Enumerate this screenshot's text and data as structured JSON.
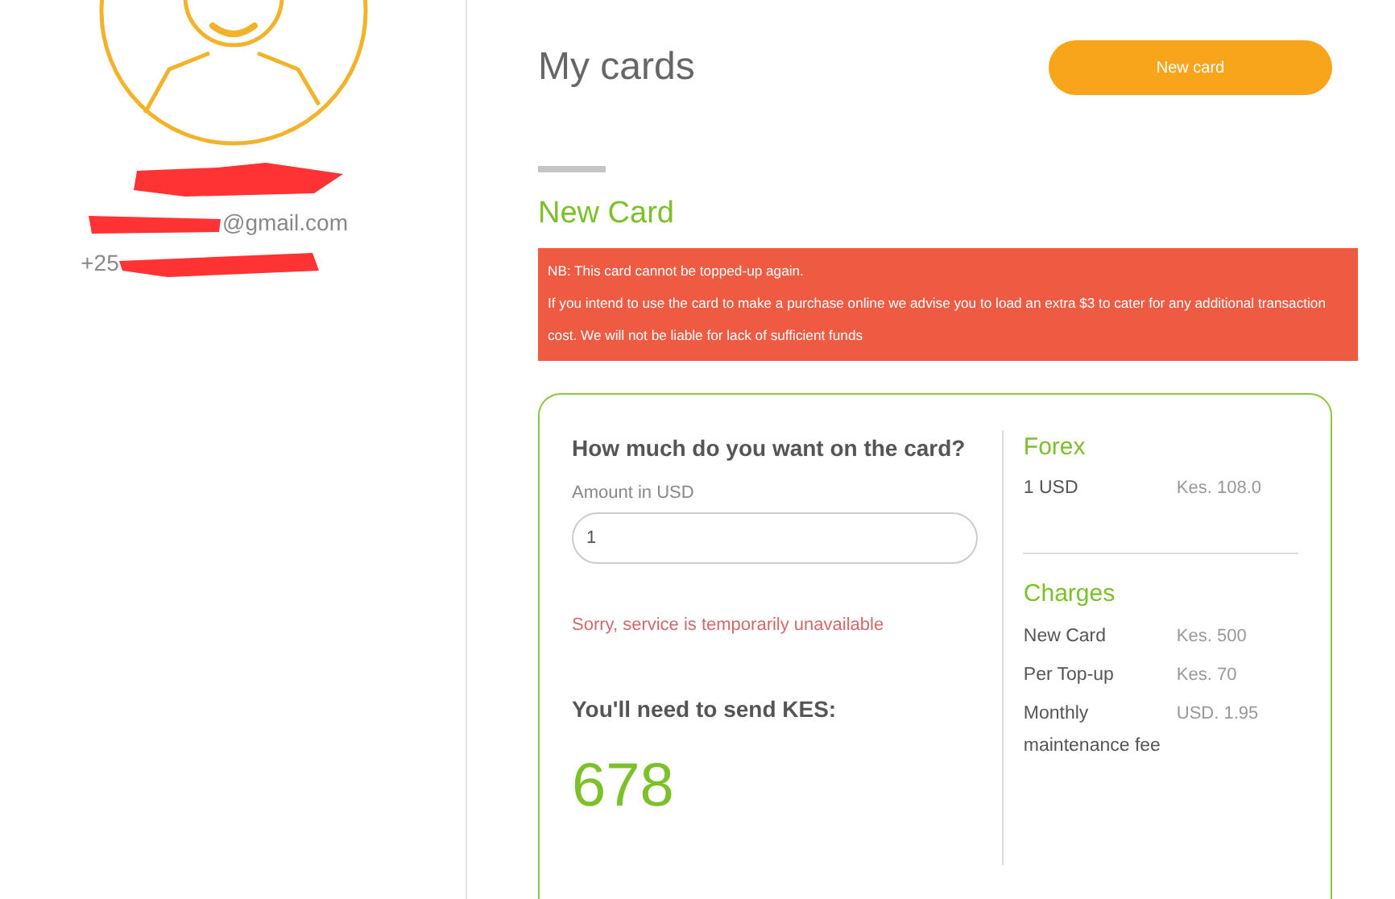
{
  "profile": {
    "email": "@gmail.com",
    "phone": "+25"
  },
  "header": {
    "title": "My cards",
    "button": "New card"
  },
  "section_title": "New Card",
  "notice": [
    "NB: This card cannot be topped-up again.",
    "If you intend to use the card to make a purchase online we advise you to load an extra $3 to cater for any additional transaction cost. We will not be liable for lack of sufficient funds"
  ],
  "form": {
    "question": "How much do you want on the card?",
    "amount_label": "Amount in USD",
    "amount_value": "1",
    "error": "Sorry, service is temporarily unavailable",
    "send_label": "You'll need to send KES:",
    "send_amount": "678"
  },
  "forex": {
    "title": "Forex",
    "rows": [
      {
        "label": "1 USD",
        "value": "Kes. 108.0"
      }
    ]
  },
  "charges": {
    "title": "Charges",
    "rows": [
      {
        "label": "New Card",
        "value": "Kes. 500"
      },
      {
        "label": "Per Top-up",
        "value": "Kes. 70"
      },
      {
        "label": "Monthly maintenance fee",
        "value": "USD. 1.95"
      }
    ]
  }
}
